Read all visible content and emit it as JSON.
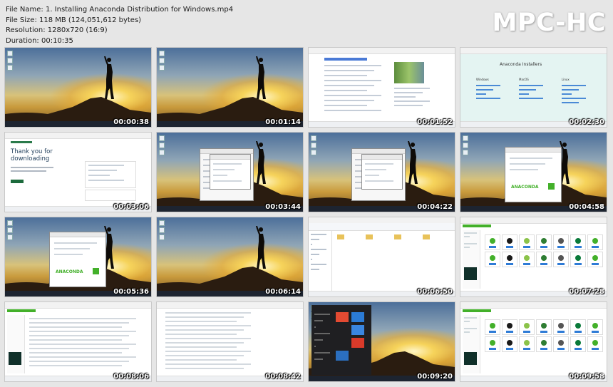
{
  "file_info": {
    "file_name": "File Name: 1. Installing Anaconda Distribution for Windows.mp4",
    "file_size": "File Size: 118 MB (124,051,612 bytes)",
    "resolution": "Resolution: 1280x720 (16:9)",
    "duration": "Duration: 00:10:35"
  },
  "brand": "MPC-HC",
  "thumbnails": [
    {
      "time": "00:00:38",
      "scene": "desktop"
    },
    {
      "time": "00:01:14",
      "scene": "desktop"
    },
    {
      "time": "00:01:52",
      "scene": "search"
    },
    {
      "time": "00:02:30",
      "scene": "installers",
      "heading": "Anaconda Installers",
      "os": [
        "Windows",
        "MacOS",
        "Linux"
      ]
    },
    {
      "time": "00:03:06",
      "scene": "thanks",
      "heading": "Thank you for downloading"
    },
    {
      "time": "00:03:44",
      "scene": "dialog"
    },
    {
      "time": "00:04:22",
      "scene": "dialog"
    },
    {
      "time": "00:04:58",
      "scene": "dialog-logo"
    },
    {
      "time": "00:05:36",
      "scene": "dialog-logo",
      "logo": "ANACONDA"
    },
    {
      "time": "00:06:14",
      "scene": "desktop"
    },
    {
      "time": "00:06:50",
      "scene": "explorer"
    },
    {
      "time": "00:07:28",
      "scene": "navigator"
    },
    {
      "time": "00:08:06",
      "scene": "list"
    },
    {
      "time": "00:08:42",
      "scene": "folder"
    },
    {
      "time": "00:09:20",
      "scene": "start"
    },
    {
      "time": "00:09:58",
      "scene": "navigator"
    }
  ],
  "colors": {
    "anaconda_green": "#43b02a",
    "accent": "#0a7a3a",
    "start_red": "#e34a32",
    "start_blue": "#2b7bd6"
  }
}
